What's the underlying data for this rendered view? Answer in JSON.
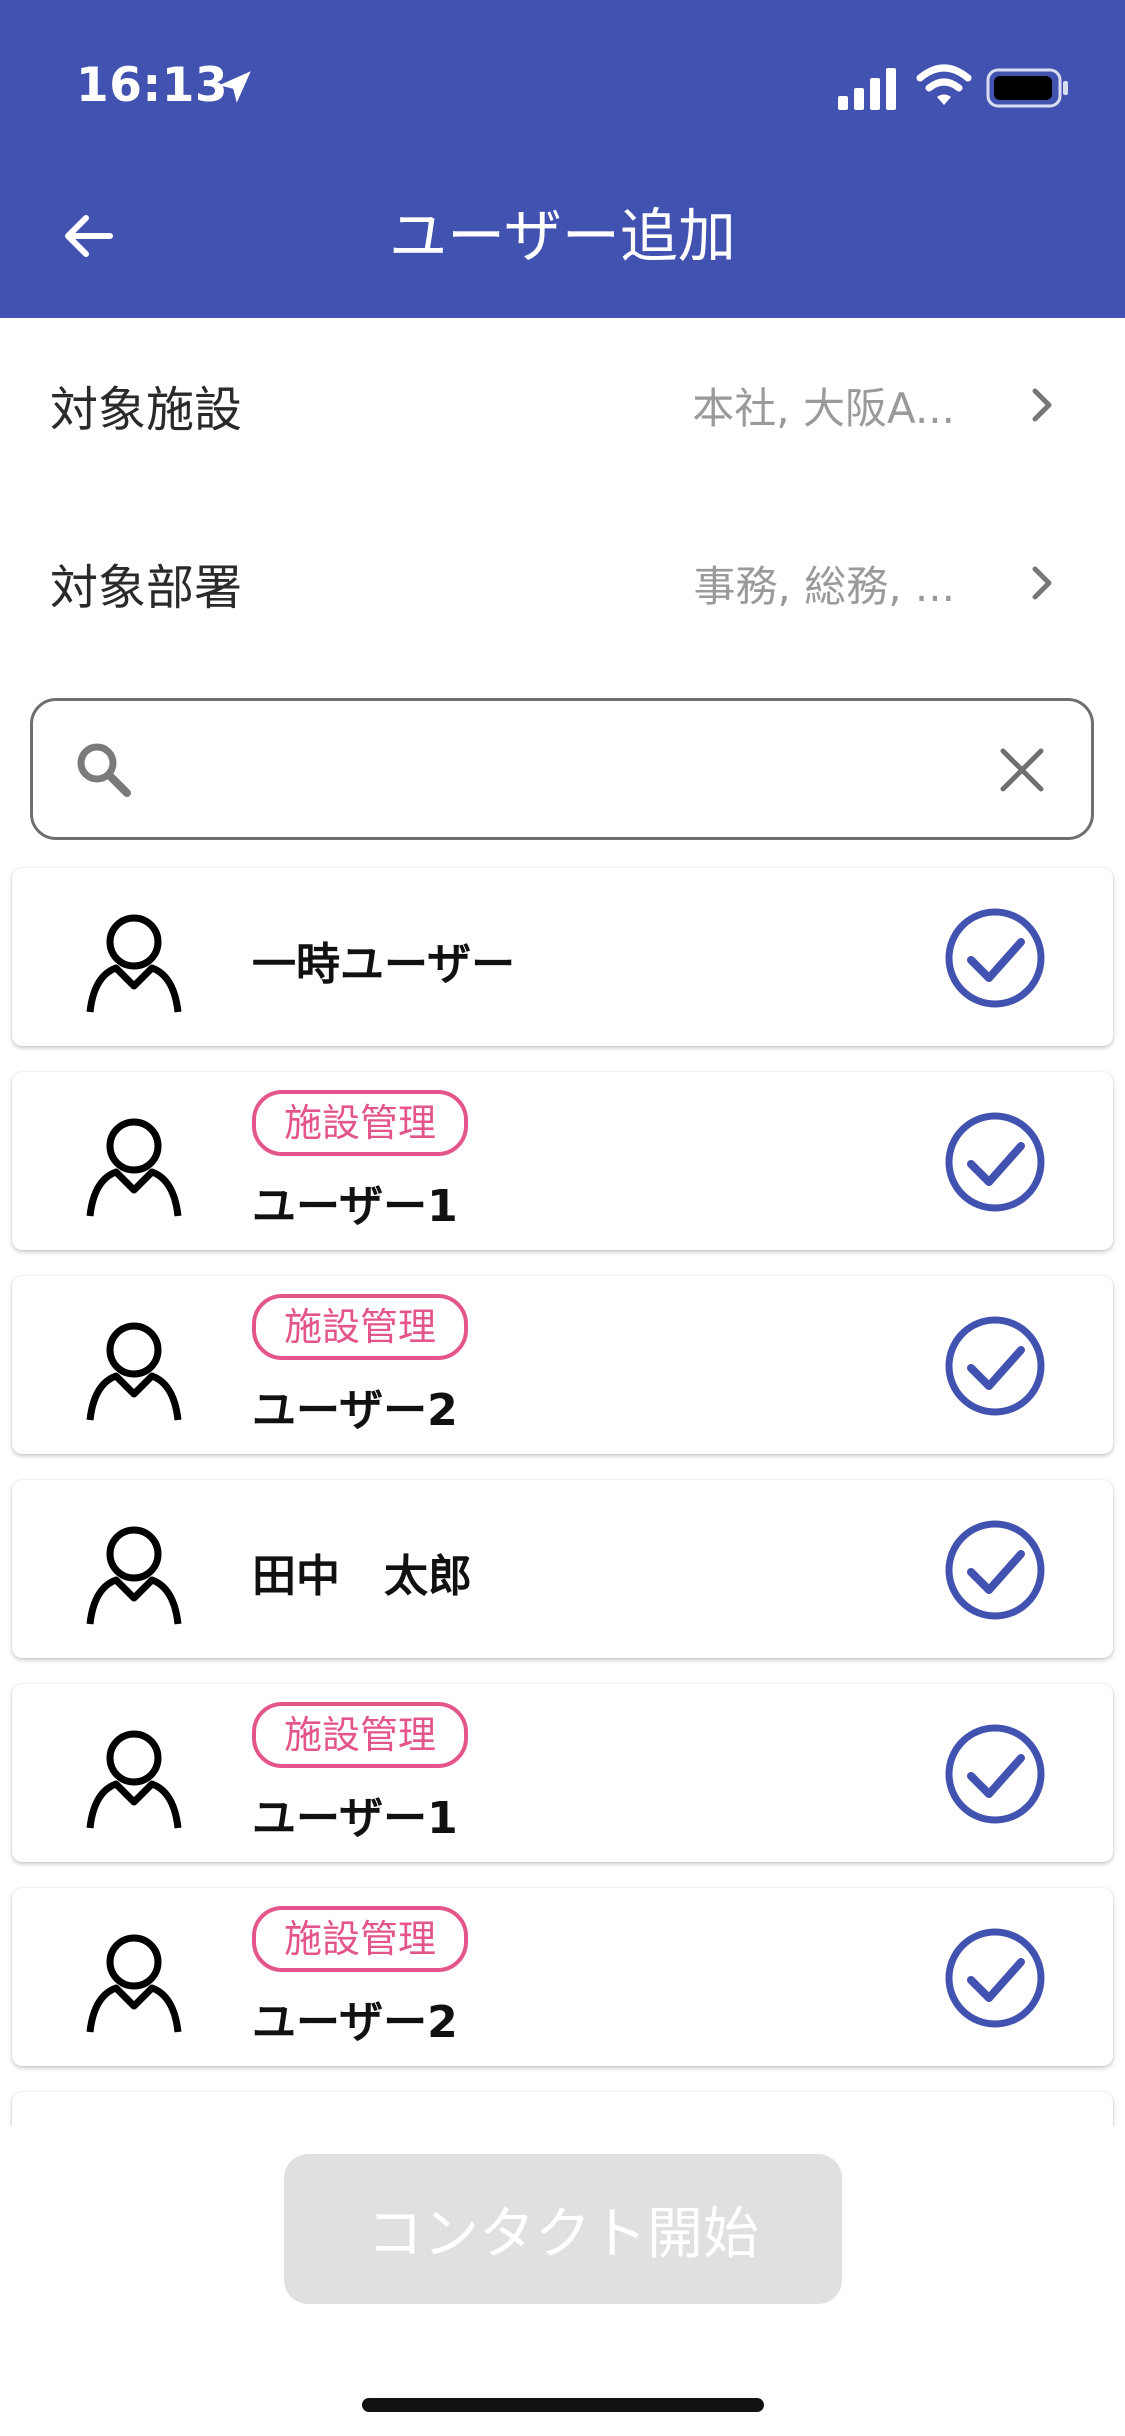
{
  "status_bar": {
    "time": "16:13"
  },
  "header": {
    "title": "ユーザー追加",
    "background_color": "#4252b0"
  },
  "filters": [
    {
      "label": "対象施設",
      "value": "本社, 大阪A..."
    },
    {
      "label": "対象部署",
      "value": "事務, 総務, ..."
    }
  ],
  "search": {
    "value": "",
    "placeholder": ""
  },
  "users": [
    {
      "name": "一時ユーザー",
      "badge": null,
      "checked": true
    },
    {
      "name": "ユーザー1",
      "badge": "施設管理",
      "checked": true
    },
    {
      "name": "ユーザー2",
      "badge": "施設管理",
      "checked": true
    },
    {
      "name": "田中　太郎",
      "badge": null,
      "checked": true
    },
    {
      "name": "ユーザー1",
      "badge": "施設管理",
      "checked": true
    },
    {
      "name": "ユーザー2",
      "badge": "施設管理",
      "checked": true
    }
  ],
  "actions": {
    "contact_label": "コンタクト開始",
    "contact_enabled": false
  },
  "colors": {
    "primary": "#4252b0",
    "badge": "#e4568b",
    "disabled_button": "#e0e0e0"
  }
}
